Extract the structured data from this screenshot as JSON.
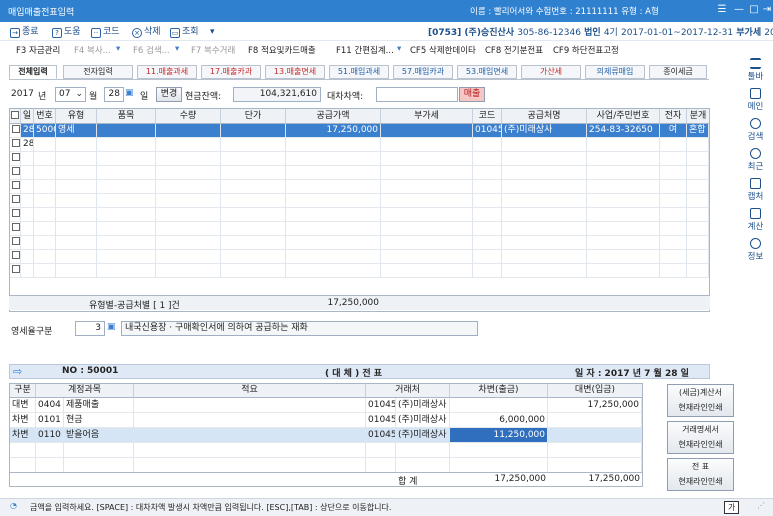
{
  "window": {
    "title": "매입매출전표입력",
    "user_info": "이름 : 빨리어서와    수험번호 : 21111111    유형 : A형"
  },
  "company": {
    "code": "[0753]",
    "name": "(주)승진산사",
    "biz_no": "305-86-12346",
    "type": "법인",
    "term": "4기",
    "period": "2017-01-01~2017-12-31",
    "vat": "부가세",
    "year": "2017"
  },
  "toolbar": {
    "close": "종료",
    "help": "도움",
    "code": "코드",
    "delete": "삭제",
    "view": "조회"
  },
  "fkeys": [
    "F3 자금관리",
    "F4 복사...",
    "F6 검색...",
    "F7 복수거래",
    "F8 적요및카드매출",
    "F11 간편집계...",
    "CF5 삭제한데이타",
    "CF8 전기분전표",
    "CF9 하단전표고정"
  ],
  "tabs": [
    {
      "label": "전체입력"
    },
    {
      "label": "전자입력"
    },
    {
      "label": "11.매출과세"
    },
    {
      "label": "17.매출카과"
    },
    {
      "label": "13.매출면세"
    },
    {
      "label": "51.매입과세"
    },
    {
      "label": "57.매입카과"
    },
    {
      "label": "53.매입면세"
    },
    {
      "label": "가산세"
    },
    {
      "label": "의제류매입"
    },
    {
      "label": "종이세금"
    }
  ],
  "date": {
    "year": "2017",
    "year_unit": "년",
    "month": "07",
    "month_unit": "월",
    "day": "28",
    "day_unit": "일",
    "change_btn": "변경",
    "cash_label": "현금잔액:",
    "cash_value": "104,321,610",
    "diff_label": "대차차액:",
    "diff_value": "",
    "sales_btn": "매출"
  },
  "grid": {
    "headers": [
      "일",
      "번호",
      "유형",
      "품목",
      "수량",
      "단가",
      "공급가액",
      "부가세",
      "코드",
      "공급처명",
      "사업/주민번호",
      "전자",
      "분개"
    ],
    "rows": [
      {
        "day": "28",
        "no": "50001",
        "type": "영세",
        "item": "",
        "qty": "",
        "price": "",
        "amount": "17,250,000",
        "vat": "",
        "code": "01045",
        "vendor": "(주)미래상사",
        "bizno": "254-83-32650",
        "elec": "여",
        "journal": "혼합"
      },
      {
        "day": "28",
        "no": "",
        "type": "",
        "item": "",
        "qty": "",
        "price": "",
        "amount": "",
        "vat": "",
        "code": "",
        "vendor": "",
        "bizno": "",
        "elec": "",
        "journal": ""
      }
    ],
    "summary_label": "유형별-공급처별 [ 1 ]건",
    "summary_amount": "17,250,000"
  },
  "tax": {
    "label": "영세율구분",
    "value": "3",
    "desc": "내국신용장 · 구매확인서에 의하여 공급하는 재화"
  },
  "voucher": {
    "no": "NO : 50001",
    "title": "( 대 체 )  전 표",
    "date": "일 자 : 2017 년  7 월 28 일",
    "headers": [
      "구분",
      "계정과목",
      "적요",
      "거래처",
      "차변(출금)",
      "대변(입금)"
    ],
    "rows": [
      {
        "div": "대변",
        "code": "0404",
        "account": "제품매출",
        "memo": "",
        "ccode": "01045",
        "client": "(주)미래상사",
        "debit": "",
        "credit": "17,250,000"
      },
      {
        "div": "차변",
        "code": "0101",
        "account": "현금",
        "memo": "",
        "ccode": "01045",
        "client": "(주)미래상사",
        "debit": "6,000,000",
        "credit": ""
      },
      {
        "div": "차변",
        "code": "0110",
        "account": "받을어음",
        "memo": "",
        "ccode": "01045",
        "client": "(주)미래상사",
        "debit": "11,250,000",
        "credit": ""
      }
    ],
    "total_label": "합   계",
    "total_debit": "17,250,000",
    "total_credit": "17,250,000"
  },
  "right_buttons": [
    "(세금)계산서\n현재라인인쇄",
    "거래명세서\n현재라인인쇄",
    "전  표\n현재라인인쇄"
  ],
  "rightbar": [
    "툴바",
    "메인",
    "검색",
    "최근",
    "캡처",
    "계산",
    "정보"
  ],
  "status": "금액을 입력하세요. [SPACE] : 대차차액 발생시 차액만큼 입력됩니다. [ESC],[TAB] : 상단으로 이동합니다.",
  "status_key": "가"
}
